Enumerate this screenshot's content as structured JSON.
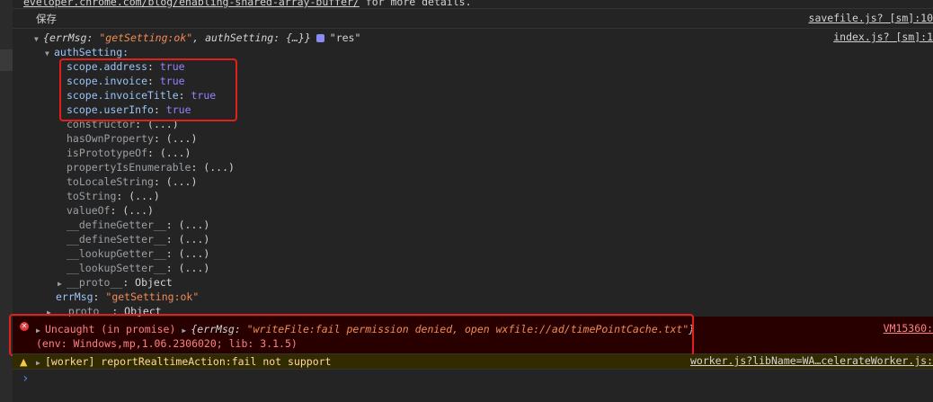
{
  "top_row": {
    "link": "eveloper.chrome.com/blog/enabling-shared-array-buffer/",
    "text": " for more details."
  },
  "log_save": {
    "text": "保存",
    "source": "savefile.js? [sm]:10"
  },
  "log_res": {
    "source": "index.js? [sm]:1",
    "summary_open": "{",
    "k_errMsg": "errMsg",
    "sep1": ": ",
    "v_errMsg": "\"getSetting:ok\"",
    "sep2": ", ",
    "k_authSetting": "authSetting",
    "v_authSetting": ": {…}}",
    "label": "\"res\""
  },
  "auth_setting_label": "authSetting:",
  "scopes": [
    {
      "key": "scope.address",
      "sep": ": ",
      "value": "true"
    },
    {
      "key": "scope.invoice",
      "sep": ": ",
      "value": "true"
    },
    {
      "key": "scope.invoiceTitle",
      "sep": ": ",
      "value": "true"
    },
    {
      "key": "scope.userInfo",
      "sep": ": ",
      "value": "true"
    }
  ],
  "proto_props": [
    {
      "key": "constructor",
      "value": ": (...)"
    },
    {
      "key": "hasOwnProperty",
      "value": ": (...)"
    },
    {
      "key": "isPrototypeOf",
      "value": ": (...)"
    },
    {
      "key": "propertyIsEnumerable",
      "value": ": (...)"
    },
    {
      "key": "toLocaleString",
      "value": ": (...)"
    },
    {
      "key": "toString",
      "value": ": (...)"
    },
    {
      "key": "valueOf",
      "value": ": (...)"
    },
    {
      "key": "__defineGetter__",
      "value": ": (...)"
    },
    {
      "key": "__defineSetter__",
      "value": ": (...)"
    },
    {
      "key": "__lookupGetter__",
      "value": ": (...)"
    },
    {
      "key": "__lookupSetter__",
      "value": ": (...)"
    }
  ],
  "inner_proto": {
    "key": "__proto__",
    "value": ": Object"
  },
  "err_msg_prop": {
    "key": "errMsg",
    "sep": ": ",
    "value": "\"getSetting:ok\""
  },
  "outer_proto": {
    "key": "__proto__",
    "value": ": Object"
  },
  "error_entry": {
    "prefix": "Uncaught (in promise) ",
    "obj_open": "{",
    "k_errMsg": "errMsg",
    "sep": ": ",
    "v_errMsg": "\"writeFile:fail permission denied, open wxfile://ad/timePointCache.txt\"",
    "obj_close": "}",
    "env": "(env: Windows,mp,1.06.2306020; lib: 3.1.5)",
    "source": "VM15360:"
  },
  "warning_entry": {
    "text": "[worker] reportRealtimeAction:fail not support",
    "source": "worker.js?libName=WA…celerateWorker.js:"
  },
  "prompt": "›",
  "colors": {
    "background": "#242424",
    "highlight_border": "#e0201b",
    "error_bg": "#290000",
    "error_text": "#ff8080",
    "warning_bg": "#332b00",
    "boolean": "#9980ff",
    "string": "#f28b54",
    "own_key": "#9cc3f5"
  },
  "icons": [
    "error-icon",
    "warning-icon",
    "info-icon",
    "expand-triangle-icon",
    "collapse-triangle-icon",
    "console-prompt-icon"
  ]
}
